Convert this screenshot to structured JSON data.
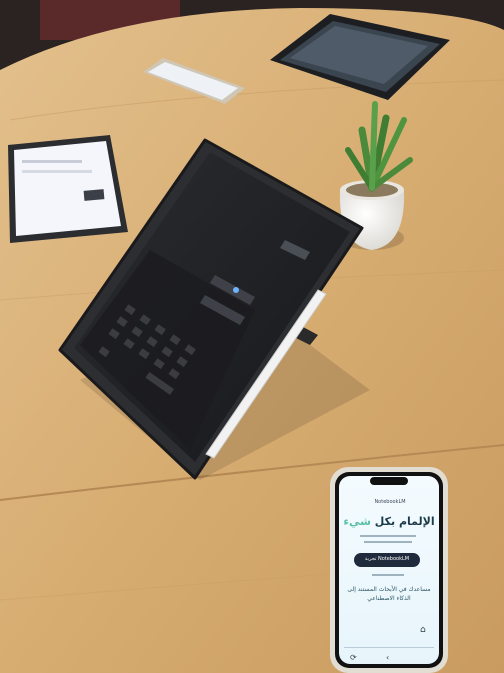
{
  "phone": {
    "brand": "NotebookLM",
    "headline_part1": "الإلمام بكل",
    "headline_highlight": "شيء",
    "cta_label": "تجربة NotebookLM",
    "tagline": "مساعدك في الأبحاث المستند إلى الذكاء الاصطناعي"
  },
  "colors": {
    "table": "#d9b27a",
    "highlight": "#5bc0a5",
    "cta": "#1f2a3c"
  }
}
